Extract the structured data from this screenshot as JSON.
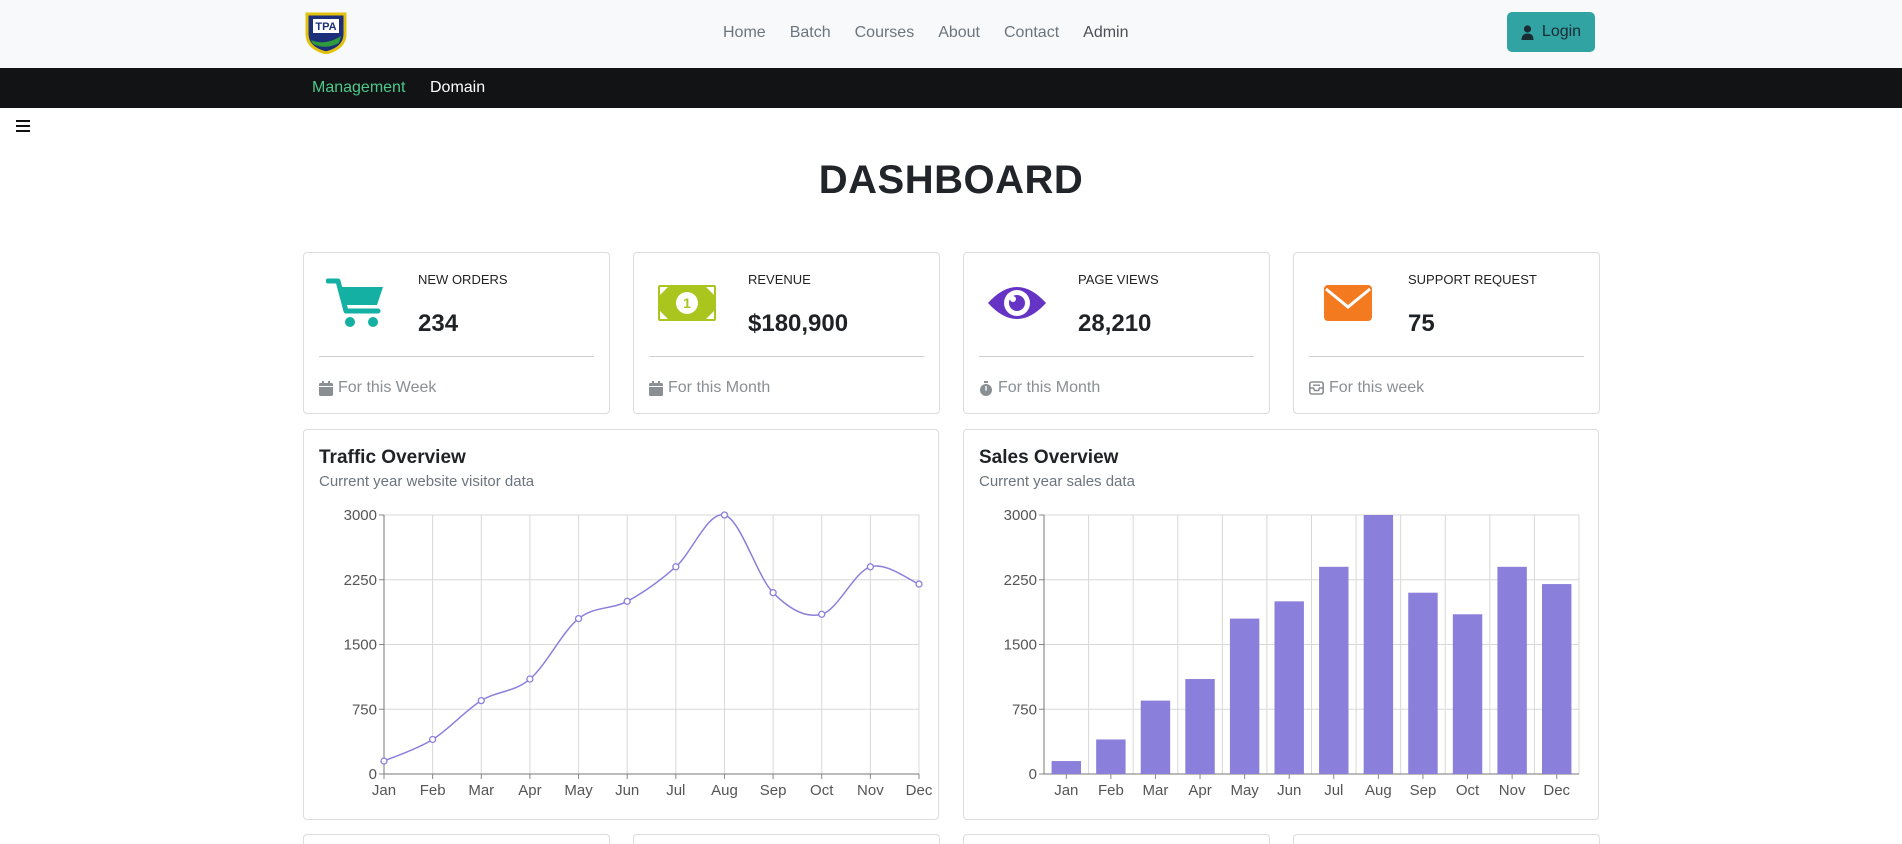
{
  "nav": {
    "links": [
      "Home",
      "Batch",
      "Courses",
      "About",
      "Contact",
      "Admin"
    ],
    "login_label": "Login",
    "logo_icon": "tpa-shield-logo"
  },
  "subnav": {
    "management": "Management",
    "domain": "Domain"
  },
  "page_title": "DASHBOARD",
  "stats": [
    {
      "label": "NEW ORDERS",
      "value": "234",
      "footer": "For this Week",
      "icon": "cart-icon",
      "color": "#14b0a3"
    },
    {
      "label": "REVENUE",
      "value": "$180,900",
      "footer": "For this Month",
      "icon": "money-icon",
      "color": "#a9c51e"
    },
    {
      "label": "PAGE VIEWS",
      "value": "28,210",
      "footer": "For this Month",
      "icon": "eye-icon",
      "color": "#6534c4"
    },
    {
      "label": "SUPPORT REQUEST",
      "value": "75",
      "footer": "For this week",
      "icon": "envelope-icon",
      "color": "#f47a20"
    }
  ],
  "traffic": {
    "title": "Traffic Overview",
    "subtitle": "Current year website visitor data"
  },
  "sales": {
    "title": "Sales Overview",
    "subtitle": "Current year sales data"
  },
  "chart_data": [
    {
      "type": "line",
      "title": "Traffic Overview",
      "categories": [
        "Jan",
        "Feb",
        "Mar",
        "Apr",
        "May",
        "Jun",
        "Jul",
        "Aug",
        "Sep",
        "Oct",
        "Nov",
        "Dec"
      ],
      "values": [
        150,
        400,
        850,
        1100,
        1800,
        2000,
        2400,
        3000,
        2100,
        1850,
        2400,
        2200
      ],
      "yticks": [
        0,
        750,
        1500,
        2250,
        3000
      ],
      "ylim": [
        0,
        3000
      ],
      "color": "#8a7fdb"
    },
    {
      "type": "bar",
      "title": "Sales Overview",
      "categories": [
        "Jan",
        "Feb",
        "Mar",
        "Apr",
        "May",
        "Jun",
        "Jul",
        "Aug",
        "Sep",
        "Oct",
        "Nov",
        "Dec"
      ],
      "values": [
        150,
        400,
        850,
        1100,
        1800,
        2000,
        2400,
        3000,
        2100,
        1850,
        2400,
        2200
      ],
      "yticks": [
        0,
        750,
        1500,
        2250,
        3000
      ],
      "ylim": [
        0,
        3000
      ],
      "color": "#8a7fdb"
    }
  ]
}
